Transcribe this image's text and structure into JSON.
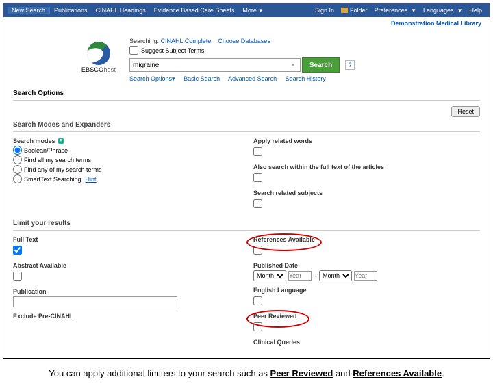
{
  "topnav": {
    "new_search": "New Search",
    "publications": "Publications",
    "cinahl_headings": "CINAHL Headings",
    "ebcs": "Evidence Based Care Sheets",
    "more": "More",
    "sign_in": "Sign In",
    "folder": "Folder",
    "preferences": "Preferences",
    "languages": "Languages",
    "help": "Help"
  },
  "subbar": {
    "demo": "Demonstration Medical Library"
  },
  "logo": {
    "brand": "EBSCO",
    "host": "host"
  },
  "search": {
    "searching_label": "Searching:",
    "db_name": "CINAHL Complete",
    "choose_db": "Choose Databases",
    "suggest": "Suggest Subject Terms",
    "query": "migraine",
    "search_btn": "Search",
    "options": "Search Options",
    "basic": "Basic Search",
    "advanced": "Advanced Search",
    "history": "Search History"
  },
  "sections": {
    "search_options": "Search Options",
    "reset": "Reset",
    "modes_expanders": "Search Modes and Expanders",
    "limit_results": "Limit your results"
  },
  "modes": {
    "label": "Search modes",
    "boolean": "Boolean/Phrase",
    "find_all": "Find all my search terms",
    "find_any": "Find any of my search terms",
    "smart": "SmartText Searching",
    "hint": "Hint"
  },
  "expanders": {
    "related": "Apply related words",
    "fulltext_articles": "Also search within the full text of the articles",
    "related_subjects": "Search related subjects"
  },
  "limiters": {
    "full_text": "Full Text",
    "abstract": "Abstract Available",
    "publication": "Publication",
    "exclude_pre": "Exclude Pre-CINAHL",
    "references": "References Available",
    "published_date": "Published Date",
    "month": "Month",
    "year_ph": "Year",
    "english": "English Language",
    "peer": "Peer Reviewed",
    "clinical": "Clinical Queries"
  },
  "caption": {
    "pre": "You can apply additional limiters to your search such as ",
    "peer": "Peer Reviewed",
    "mid": " and ",
    "ref": "References Available",
    "post": "."
  }
}
